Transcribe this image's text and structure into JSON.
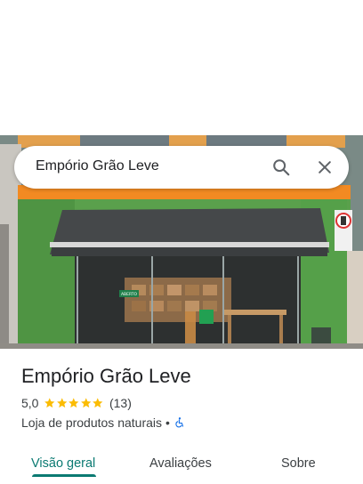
{
  "search": {
    "query": "Empório Grão Leve"
  },
  "icons": {
    "search": "search-icon",
    "close": "close-icon",
    "star": "star-icon",
    "accessibility": "wheelchair-icon"
  },
  "place": {
    "title": "Empório Grão Leve",
    "rating": "5,0",
    "stars": 5,
    "reviews": "(13)",
    "category": "Loja de produtos naturais",
    "separator": "•"
  },
  "photo": {
    "sign": "ABERTO"
  },
  "tabs": [
    {
      "label": "Visão geral",
      "active": true
    },
    {
      "label": "Avaliações",
      "active": false
    },
    {
      "label": "Sobre",
      "active": false
    }
  ],
  "colors": {
    "accent": "#0b7a72",
    "star": "#fbbc04",
    "wall_green": "#5aa04c",
    "awning": "#45484a"
  }
}
